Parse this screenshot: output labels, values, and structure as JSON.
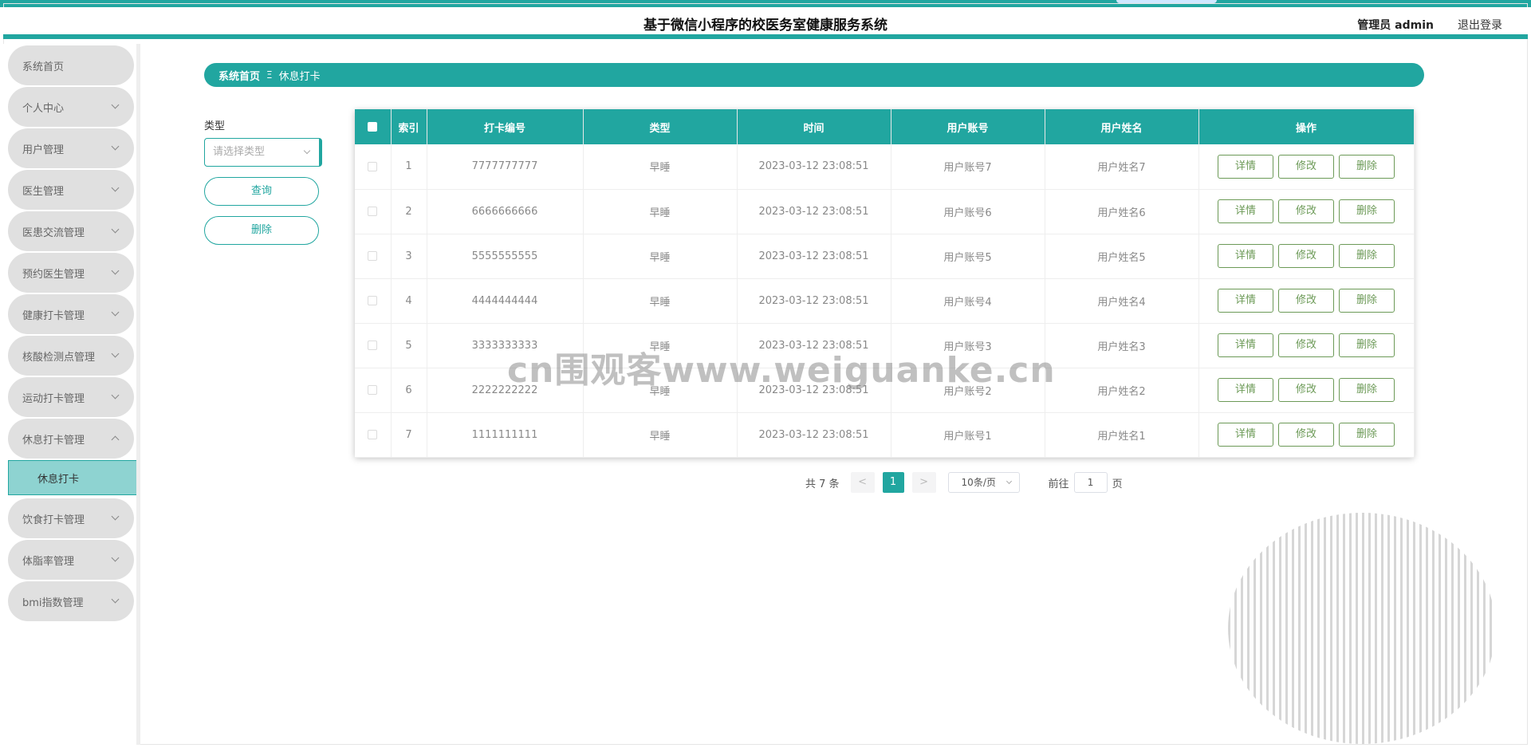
{
  "header": {
    "title": "基于微信小程序的校医务室健康服务系统",
    "user": "管理员 admin",
    "logout": "退出登录"
  },
  "sidebar": {
    "items": [
      {
        "label": "系统首页"
      },
      {
        "label": "个人中心"
      },
      {
        "label": "用户管理"
      },
      {
        "label": "医生管理"
      },
      {
        "label": "医患交流管理"
      },
      {
        "label": "预约医生管理"
      },
      {
        "label": "健康打卡管理"
      },
      {
        "label": "核酸检测点管理"
      },
      {
        "label": "运动打卡管理"
      },
      {
        "label": "休息打卡管理"
      },
      {
        "label": "饮食打卡管理"
      },
      {
        "label": "体脂率管理"
      },
      {
        "label": "bmi指数管理"
      }
    ],
    "active_sub": "休息打卡"
  },
  "breadcrumb": {
    "home": "系统首页",
    "separator": "Ξ",
    "current": "休息打卡"
  },
  "filter": {
    "label": "类型",
    "placeholder": "请选择类型",
    "query_button": "查询",
    "delete_button": "删除"
  },
  "table": {
    "columns": [
      "索引",
      "打卡编号",
      "类型",
      "时间",
      "用户账号",
      "用户姓名",
      "操作"
    ],
    "rows": [
      {
        "index": "1",
        "code": "7777777777",
        "type": "早睡",
        "time": "2023-03-12 23:08:51",
        "account": "用户账号7",
        "name": "用户姓名7"
      },
      {
        "index": "2",
        "code": "6666666666",
        "type": "早睡",
        "time": "2023-03-12 23:08:51",
        "account": "用户账号6",
        "name": "用户姓名6"
      },
      {
        "index": "3",
        "code": "5555555555",
        "type": "早睡",
        "time": "2023-03-12 23:08:51",
        "account": "用户账号5",
        "name": "用户姓名5"
      },
      {
        "index": "4",
        "code": "4444444444",
        "type": "早睡",
        "time": "2023-03-12 23:08:51",
        "account": "用户账号4",
        "name": "用户姓名4"
      },
      {
        "index": "5",
        "code": "3333333333",
        "type": "早睡",
        "time": "2023-03-12 23:08:51",
        "account": "用户账号3",
        "name": "用户姓名3"
      },
      {
        "index": "6",
        "code": "2222222222",
        "type": "早睡",
        "time": "2023-03-12 23:08:51",
        "account": "用户账号2",
        "name": "用户姓名2"
      },
      {
        "index": "7",
        "code": "1111111111",
        "type": "早睡",
        "time": "2023-03-12 23:08:51",
        "account": "用户账号1",
        "name": "用户姓名1"
      }
    ],
    "actions": {
      "detail": "详情",
      "edit": "修改",
      "delete": "删除"
    }
  },
  "pagination": {
    "total": "共 7 条",
    "prev": "<",
    "current_page": "1",
    "next": ">",
    "page_size": "10条/页",
    "goto_prefix": "前往",
    "goto_value": "1",
    "goto_suffix": "页"
  },
  "watermark": "cn围观客www.weiguanke.cn",
  "colors": {
    "accent": "#21a6a0",
    "sidebar_item": "#e0e0e0",
    "sidebar_active": "#8ed3d1",
    "action_button": "#6c9a57"
  }
}
